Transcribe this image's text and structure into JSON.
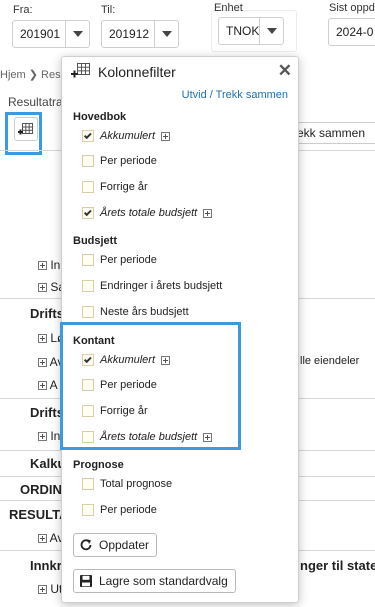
{
  "filters": {
    "fra": {
      "label": "Fra:",
      "value": "201901"
    },
    "til": {
      "label": "Til:",
      "value": "201912"
    },
    "enhet": {
      "label": "Enhet",
      "value": "TNOK"
    },
    "sist_oppdatert": {
      "label": "Sist oppd",
      "value": "2024-0"
    }
  },
  "breadcrumb": {
    "home": "Hjem",
    "current": "Resu"
  },
  "page": {
    "section_title": "Resultatra",
    "expand_button": "ekk sammen"
  },
  "background_rows": [
    {
      "text": "Inn",
      "has_toggle": true,
      "bold": false
    },
    {
      "text": "Sa",
      "has_toggle": true,
      "bold": false
    },
    {
      "text": "Drifts",
      "has_toggle": false,
      "bold": true
    },
    {
      "text": "Lø",
      "has_toggle": true,
      "bold": false
    },
    {
      "text": "Av",
      "has_toggle": true,
      "bold": false
    },
    {
      "text": "A",
      "has_toggle": true,
      "bold": false
    },
    {
      "text": "Drifts",
      "has_toggle": false,
      "bold": true
    },
    {
      "text": "In",
      "has_toggle": true,
      "bold": false
    },
    {
      "text": "Kalku",
      "has_toggle": false,
      "bold": true
    },
    {
      "text": "ORDIN",
      "has_toggle": false,
      "bold": true
    },
    {
      "text": "RESULTA",
      "has_toggle": false,
      "bold": true
    },
    {
      "text": "Av",
      "has_toggle": true,
      "bold": false
    },
    {
      "text": "Innkre",
      "has_toggle": false,
      "bold": true
    },
    {
      "text": "Ut",
      "has_toggle": true,
      "bold": false
    }
  ],
  "background_right": {
    "eiendeler": "lle eiendeler",
    "staten": "nger til staten"
  },
  "column_filter": {
    "title": "Kolonnefilter",
    "toggle_link": "Utvid / Trekk sammen",
    "sections": [
      {
        "heading": "Hovedbok",
        "options": [
          {
            "label": "Akkumulert",
            "checked": true,
            "italic": true,
            "expandable": true
          },
          {
            "label": "Per periode",
            "checked": false,
            "italic": false,
            "expandable": false
          },
          {
            "label": "Forrige år",
            "checked": false,
            "italic": false,
            "expandable": false
          },
          {
            "label": "Årets totale budsjett",
            "checked": true,
            "italic": true,
            "expandable": true
          }
        ]
      },
      {
        "heading": "Budsjett",
        "options": [
          {
            "label": "Per periode",
            "checked": false,
            "italic": false,
            "expandable": false
          },
          {
            "label": "Endringer i årets budsjett",
            "checked": false,
            "italic": false,
            "expandable": false
          },
          {
            "label": "Neste års budsjett",
            "checked": false,
            "italic": false,
            "expandable": false
          }
        ]
      },
      {
        "heading": "Kontant",
        "options": [
          {
            "label": "Akkumulert",
            "checked": true,
            "italic": true,
            "expandable": true
          },
          {
            "label": "Per periode",
            "checked": false,
            "italic": false,
            "expandable": false
          },
          {
            "label": "Forrige år",
            "checked": false,
            "italic": false,
            "expandable": false
          },
          {
            "label": "Årets totale budsjett",
            "checked": false,
            "italic": true,
            "expandable": true
          }
        ]
      },
      {
        "heading": "Prognose",
        "options": [
          {
            "label": "Total prognose",
            "checked": false,
            "italic": false,
            "expandable": false
          },
          {
            "label": "Per periode",
            "checked": false,
            "italic": false,
            "expandable": false
          }
        ]
      }
    ],
    "update_button": "Oppdater",
    "save_default_button": "Lagre som standardvalg"
  },
  "icons": {
    "grid": "table-grid-icon",
    "refresh": "refresh-icon",
    "save": "save-disk-icon",
    "close": "close-icon"
  },
  "colors": {
    "highlight": "#3a9be3",
    "link": "#1f6fb2",
    "checkbox_bg": "#fffdf2"
  }
}
